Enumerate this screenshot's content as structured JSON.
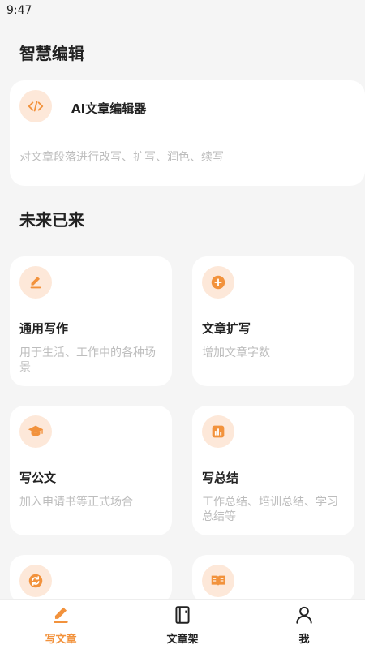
{
  "status": {
    "time": "9:47"
  },
  "section1": {
    "title": "智慧编辑"
  },
  "editor_card": {
    "title": "AI文章编辑器",
    "desc": "对文章段落进行改写、扩写、润色、续写",
    "icon": "code-icon"
  },
  "section2": {
    "title": "未来已来"
  },
  "features": [
    {
      "title": "通用写作",
      "desc": "用于生活、工作中的各种场景",
      "icon": "pen-icon"
    },
    {
      "title": "文章扩写",
      "desc": "增加文章字数",
      "icon": "plus-circle-icon"
    },
    {
      "title": "写公文",
      "desc": "加入申请书等正式场合",
      "icon": "graduation-cap-icon"
    },
    {
      "title": "写总结",
      "desc": "工作总结、培训总结、学习总结等",
      "icon": "bar-chart-icon"
    },
    {
      "title": "",
      "desc": "",
      "icon": "refresh-icon"
    },
    {
      "title": "",
      "desc": "",
      "icon": "book-icon"
    }
  ],
  "nav": [
    {
      "label": "写文章",
      "icon": "pen-icon",
      "active": true
    },
    {
      "label": "文章架",
      "icon": "notebook-icon",
      "active": false
    },
    {
      "label": "我",
      "icon": "user-icon",
      "active": false
    }
  ],
  "colors": {
    "accent": "#f2923c",
    "icon_bg": "#fde8d9",
    "background": "#f5f5f5"
  }
}
